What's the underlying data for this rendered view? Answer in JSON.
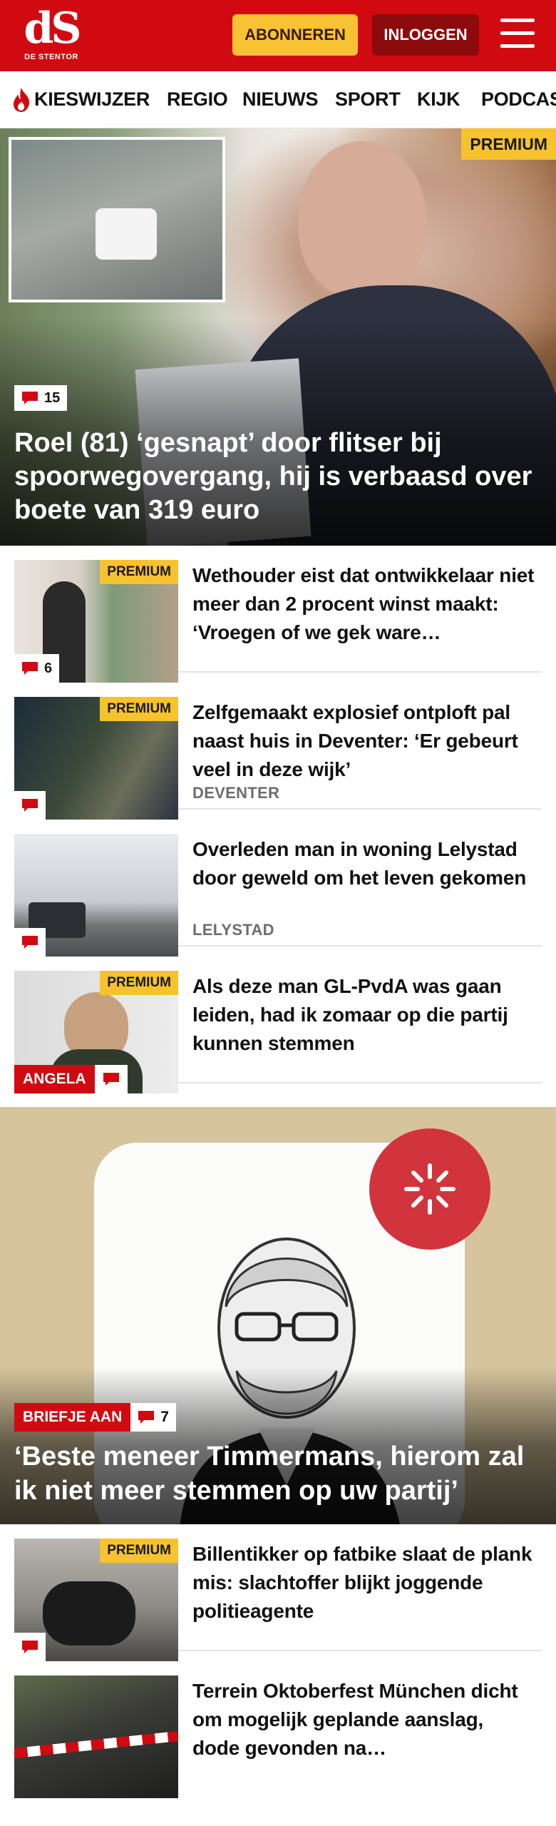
{
  "header": {
    "logo_mark": "dS",
    "logo_sub": "DE STENTOR",
    "subscribe_label": "ABONNEREN",
    "login_label": "INLOGGEN"
  },
  "nav": {
    "items": [
      "KIESWIJZER",
      "REGIO",
      "NIEUWS",
      "SPORT",
      "KIJK",
      "PODCAS"
    ]
  },
  "colors": {
    "brand_red": "#d10a11",
    "premium_yellow": "#f6c22d",
    "dark_red": "#8c0b0d"
  },
  "hero": {
    "badge": "PREMIUM",
    "comment_count": "15",
    "title": "Roel (81) ‘gesnapt’ door flitser bij spoorwegovergang, hij is verbaasd over boete van 319 euro"
  },
  "articles": [
    {
      "badge": "PREMIUM",
      "comment_count": "6",
      "title": "Wethouder eist dat ontwikkelaar niet meer dan 2 procent winst maakt: ‘Vroegen of we gek ware…",
      "tag": ""
    },
    {
      "badge": "PREMIUM",
      "comment_count": "",
      "title": "Zelfgemaakt explosief ontploft pal naast huis in Deventer: ‘Er gebeurt veel in deze wijk’",
      "tag": "DEVENTER"
    },
    {
      "badge": "",
      "comment_count": "",
      "title": "Overleden man in woning Lelystad door geweld om het leven gekomen",
      "tag": "LELYSTAD"
    },
    {
      "badge": "PREMIUM",
      "author_tag": "ANGELA",
      "comment_count": "",
      "title": "Als deze man GL-PvdA was gaan leiden, had ik zomaar op die partij kunnen stemmen",
      "tag": ""
    }
  ],
  "feature": {
    "label": "BRIEFJE AAN",
    "comment_count": "7",
    "title": "‘Beste meneer Timmermans, hierom zal ik niet meer stemmen op uw partij’"
  },
  "articles_bottom": [
    {
      "badge": "PREMIUM",
      "comment_count": "",
      "title": "Billentikker op fatbike slaat de plank mis: slachtoffer blijkt joggende politieagente"
    },
    {
      "badge": "",
      "comment_count": "",
      "title": "Terrein Oktoberfest München dicht om mogelijk geplande aanslag, dode gevonden na…"
    }
  ],
  "icons": [
    "flame-icon",
    "menu-icon",
    "comment-icon"
  ]
}
